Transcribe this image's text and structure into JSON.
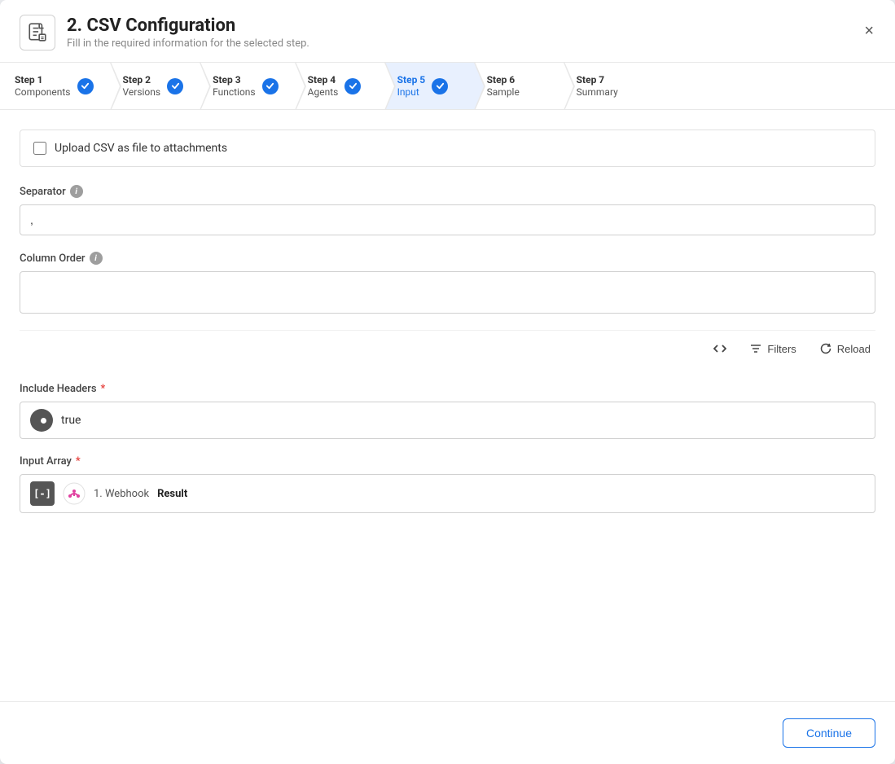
{
  "modal": {
    "title": "2. CSV Configuration",
    "subtitle": "Fill in the required information for the selected step.",
    "close_label": "×"
  },
  "steps": [
    {
      "id": "step1",
      "label": "Step 1",
      "sublabel": "Components",
      "completed": true,
      "active": false
    },
    {
      "id": "step2",
      "label": "Step 2",
      "sublabel": "Versions",
      "completed": true,
      "active": false
    },
    {
      "id": "step3",
      "label": "Step 3",
      "sublabel": "Functions",
      "completed": true,
      "active": false
    },
    {
      "id": "step4",
      "label": "Step 4",
      "sublabel": "Agents",
      "completed": true,
      "active": false
    },
    {
      "id": "step5",
      "label": "Step 5",
      "sublabel": "Input",
      "completed": true,
      "active": true
    },
    {
      "id": "step6",
      "label": "Step 6",
      "sublabel": "Sample",
      "completed": false,
      "active": false
    },
    {
      "id": "step7",
      "label": "Step 7",
      "sublabel": "Summary",
      "completed": false,
      "active": false
    }
  ],
  "upload_row": {
    "label": "Upload CSV as file to attachments"
  },
  "separator": {
    "label": "Separator",
    "value": ","
  },
  "column_order": {
    "label": "Column Order"
  },
  "toolbar": {
    "filters_label": "Filters",
    "reload_label": "Reload"
  },
  "include_headers": {
    "label": "Include Headers",
    "required": true,
    "value": "true"
  },
  "input_array": {
    "label": "Input Array",
    "required": true,
    "webhook_name": "1. Webhook",
    "result_label": "Result"
  },
  "footer": {
    "continue_label": "Continue"
  }
}
